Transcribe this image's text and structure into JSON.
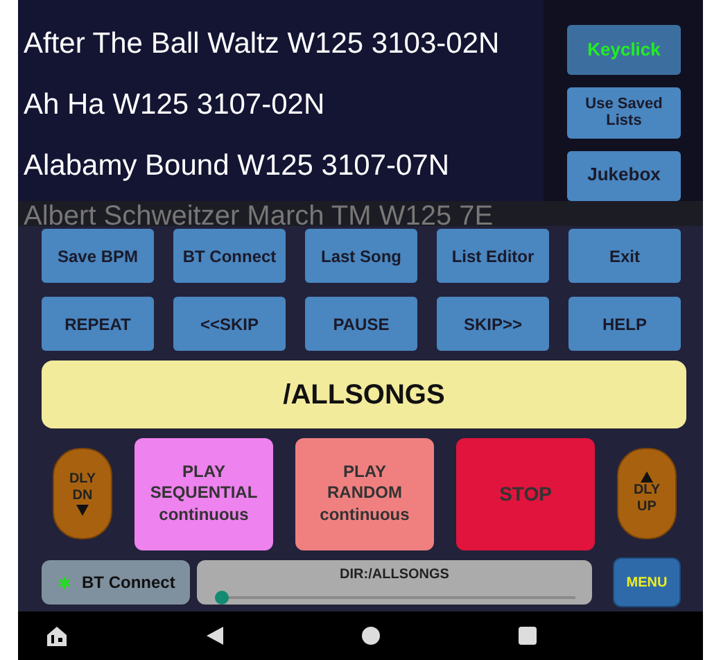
{
  "songs": [
    {
      "title": "After The Ball Waltz W125 3103-02N",
      "dimmed": false
    },
    {
      "title": "Ah Ha W125 3107-02N",
      "dimmed": false
    },
    {
      "title": "Alabamy Bound W125 3107-07N",
      "dimmed": false
    },
    {
      "title": "Albert Schweitzer March TM W125 7E",
      "dimmed": true
    }
  ],
  "side_buttons": [
    {
      "label": "Keyclick",
      "on": true
    },
    {
      "label": "Use Saved Lists",
      "on": false
    },
    {
      "label": "Jukebox",
      "on": false
    }
  ],
  "button_grid": [
    [
      "Save BPM",
      "BT Connect",
      "Last Song",
      "List Editor",
      "Exit"
    ],
    [
      "REPEAT",
      "<<SKIP",
      "PAUSE",
      "SKIP>>",
      "HELP"
    ]
  ],
  "current_list": "/ALLSONGS",
  "controls": [
    {
      "kind": "delay-down",
      "lines": [
        "DLY",
        "DN"
      ]
    },
    {
      "kind": "play",
      "lines": [
        "PLAY",
        "SEQUENTIAL",
        "continuous"
      ],
      "color": "#ee82ee"
    },
    {
      "kind": "play",
      "lines": [
        "PLAY",
        "RANDOM",
        "continuous"
      ],
      "color": "#f08080"
    },
    {
      "kind": "play",
      "lines": [
        "STOP"
      ],
      "color": "#e0143c"
    },
    {
      "kind": "delay-up",
      "lines": [
        "DLY",
        "UP"
      ]
    }
  ],
  "status": {
    "bt_button": "BT Connect",
    "directory": "DIR:/ALLSONGS",
    "level": 0.0,
    "menu": "MENU"
  }
}
